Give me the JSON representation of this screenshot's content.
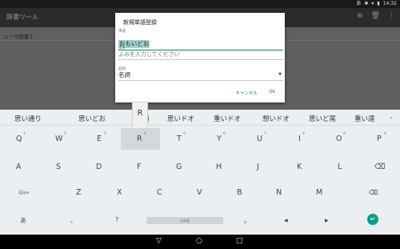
{
  "status_bar": {
    "icons": [
      "あ",
      "✱",
      "▾",
      "▮"
    ],
    "time": "14:32"
  },
  "app_bar": {
    "title": "辞書ツール",
    "actions": [
      "⊕",
      "🗑",
      "⋮"
    ]
  },
  "list": {
    "item": "ユーザ辞書１"
  },
  "dialog": {
    "title": "新規単語登録",
    "word_label": "単語",
    "word_value": "おもいどお",
    "reading_label": "よみ",
    "reading_placeholder": "よみを入力してください",
    "pos_label": "品詞",
    "pos_value": "名詞",
    "cancel_label": "キャンセル",
    "ok_label": "OK"
  },
  "key_popup": "R",
  "candidates": [
    "思い通り",
    "思いどお",
    "思遠",
    "思いドオ",
    "重いドオ",
    "想いドオ",
    "思いど尾",
    "重い遠"
  ],
  "candidates_more": "⌄",
  "keyboard": {
    "row1": [
      {
        "k": "Q",
        "s": "1"
      },
      {
        "k": "W",
        "s": "2"
      },
      {
        "k": "E",
        "s": "3"
      },
      {
        "k": "R",
        "s": "4"
      },
      {
        "k": "T",
        "s": "5"
      },
      {
        "k": "Y",
        "s": "6"
      },
      {
        "k": "U",
        "s": "7"
      },
      {
        "k": "I",
        "s": "8"
      },
      {
        "k": "O",
        "s": "9"
      },
      {
        "k": "P",
        "s": "0"
      }
    ],
    "row2": [
      "A",
      "S",
      "D",
      "F",
      "G",
      "H",
      "J",
      "K",
      "L",
      "⌫"
    ],
    "row3": [
      "☺",
      "Z",
      "X",
      "C",
      "V",
      "B",
      "N",
      "M",
      "⌫"
    ],
    "row4": {
      "lang": "あ",
      "comma": "、",
      "question": "?",
      "space": "日本語",
      "period": "。",
      "left": "◀",
      "right": "▶"
    },
    "enter": "↵",
    "emoji_sub": "記号"
  },
  "nav": {
    "back": "▽",
    "home": "○",
    "recents": "□"
  }
}
